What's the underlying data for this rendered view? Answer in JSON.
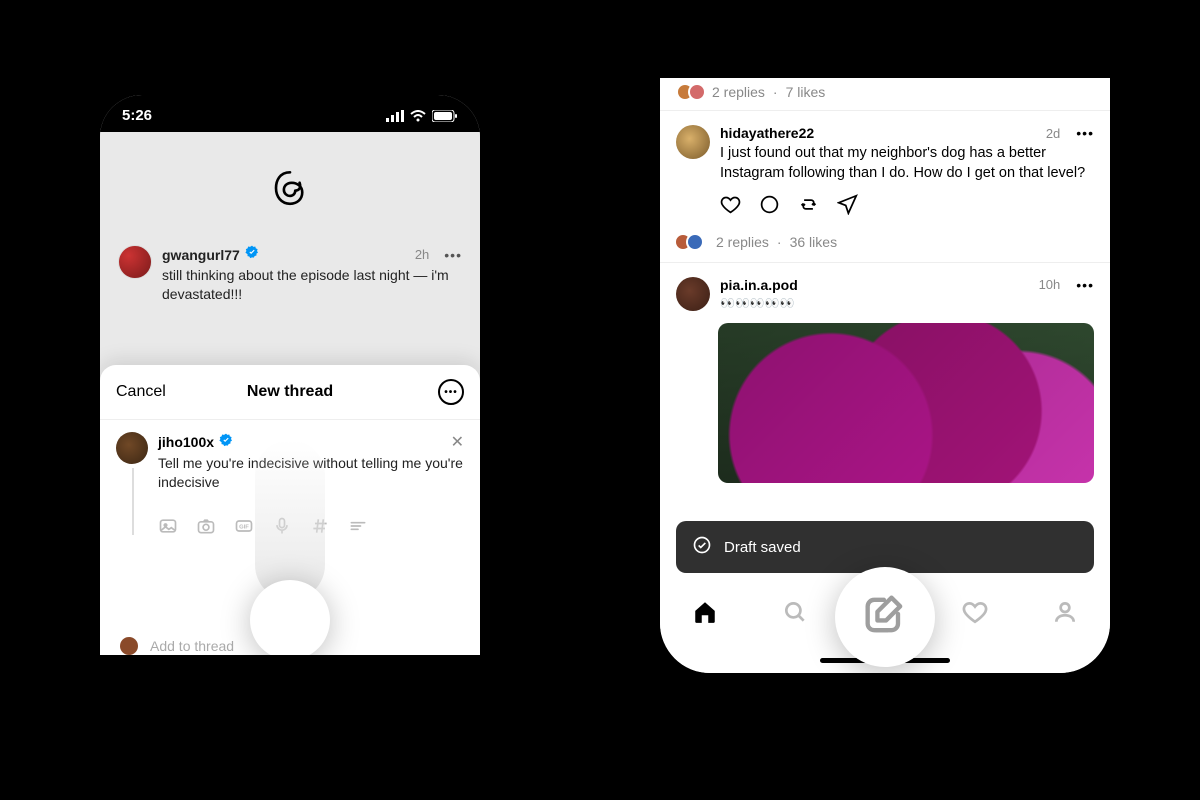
{
  "left": {
    "status_time": "5:26",
    "feed_post": {
      "user": "gwangurl77",
      "time": "2h",
      "text": "still thinking about the episode last night — i'm devastated!!!"
    },
    "composer": {
      "cancel": "Cancel",
      "title": "New thread",
      "user": "jiho100x",
      "text": "Tell me you're indecisive without telling me you're indecisive",
      "add_to_thread": "Add to thread"
    }
  },
  "right": {
    "top_stats": {
      "replies": "2 replies",
      "likes": "7 likes"
    },
    "post1": {
      "user": "hidayathere22",
      "time": "2d",
      "text": "I just found out that my neighbor's dog has a better Instagram following than I do. How do I get on that level?",
      "stats": {
        "replies": "2 replies",
        "likes": "36 likes"
      }
    },
    "post2": {
      "user": "pia.in.a.pod",
      "time": "10h",
      "text": "👀👀👀👀👀"
    },
    "toast": "Draft saved"
  },
  "sep": "·"
}
